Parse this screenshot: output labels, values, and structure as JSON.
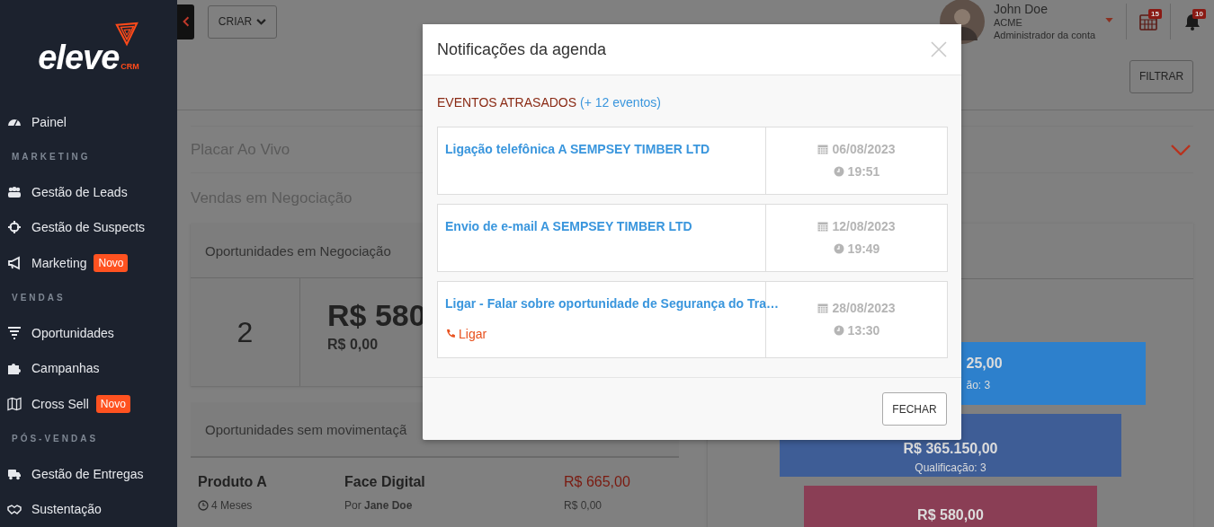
{
  "sidebar": {
    "logo": {
      "name": "eleve",
      "suffix": "CRM"
    },
    "items": [
      {
        "kind": "item",
        "label": "Painel"
      },
      {
        "kind": "section",
        "label": "MARKETING"
      },
      {
        "kind": "item",
        "label": "Gestão de Leads"
      },
      {
        "kind": "item",
        "label": "Gestão de Suspects"
      },
      {
        "kind": "item",
        "label": "Marketing",
        "badge": "Novo"
      },
      {
        "kind": "section",
        "label": "VENDAS"
      },
      {
        "kind": "item",
        "label": "Oportunidades"
      },
      {
        "kind": "item",
        "label": "Campanhas"
      },
      {
        "kind": "item",
        "label": "Cross Sell",
        "badge": "Novo"
      },
      {
        "kind": "section",
        "label": "PÓS-VENDAS"
      },
      {
        "kind": "item",
        "label": "Gestão de Entregas"
      },
      {
        "kind": "item",
        "label": "Sustentação"
      }
    ]
  },
  "header": {
    "create_button": "CRIAR",
    "user": {
      "name": "John Doe",
      "company": "ACME",
      "role": "Administrador da conta"
    },
    "calendar_badge": "15",
    "bell_badge": "10"
  },
  "toolbar": {
    "filter_button": "FILTRAR"
  },
  "live_board": {
    "title": "Placar Ao Vivo"
  },
  "sales": {
    "title": "Vendas em Negociação",
    "open_card": {
      "title": "Oportunidades em Negociação",
      "count": "2",
      "amount": "R$ 580",
      "sub_amount": "R$ 0,00"
    },
    "idle_card": {
      "title": "Oportunidades sem movimentaçã",
      "rows": [
        {
          "product": "Produto A",
          "age": "4 Meses",
          "company": "Face Digital",
          "owner": "Por **Jane Doe**",
          "value": "R$ 665,00",
          "sub_value": "R$ 0,00"
        }
      ]
    },
    "funnel": [
      {
        "value": "25,00",
        "label": "ão: 3",
        "color": "#2d80cc"
      },
      {
        "value": "R$ 365.150,00",
        "label": "Qualificação: 3",
        "color": "#3e5d96"
      },
      {
        "value": "R$ 580,00",
        "color": "#8a3e55"
      }
    ]
  },
  "modal": {
    "title": "Notificações da agenda",
    "overdue_label": "EVENTOS ATRASADOS",
    "more_link": "(+ 12 eventos)",
    "events": [
      {
        "title": "Ligação telefônica A SEMPSEY TIMBER LTD",
        "date": "06/08/2023",
        "time": "19:51"
      },
      {
        "title": "Envio de e-mail A SEMPSEY TIMBER LTD",
        "date": "12/08/2023",
        "time": "19:49"
      },
      {
        "title": "Ligar - Falar sobre oportunidade de Segurança do Tra…",
        "action": "Ligar",
        "date": "28/08/2023",
        "time": "13:30"
      }
    ],
    "close_button": "FECHAR"
  }
}
